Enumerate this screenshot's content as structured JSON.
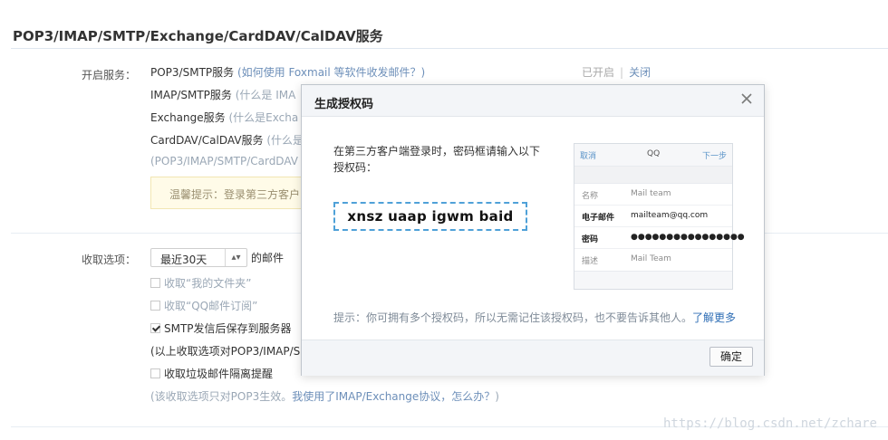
{
  "section": {
    "title": "POP3/IMAP/SMTP/Exchange/CardDAV/CalDAV服务"
  },
  "services": {
    "label": "开启服务：",
    "rows": [
      {
        "name": "POP3/SMTP服务",
        "note": " (如何使用 Foxmail 等软件收发邮件？)"
      },
      {
        "name": "IMAP/SMTP服务",
        "note": " (什么是 IMA"
      },
      {
        "name": "Exchange服务",
        "note": " (什么是Excha"
      },
      {
        "name": "CardDAV/CalDAV服务",
        "note": " (什么是"
      }
    ],
    "extra_note": "(POP3/IMAP/SMTP/CardDAV",
    "status_enabled": "已开启",
    "status_sep": "|",
    "status_off": "关闭",
    "tip": "温馨提示：登录第三方客户"
  },
  "receive": {
    "label": "收取选项：",
    "select_value": "最近30天",
    "select_suffix": "的邮件",
    "options": [
      {
        "label": "收取“我的文件夹”",
        "checked": false
      },
      {
        "label": "收取“QQ邮件订阅”",
        "checked": false
      },
      {
        "label": "SMTP发信后保存到服务器",
        "checked": true
      },
      {
        "label": "收取垃圾邮件隔离提醒",
        "checked": false
      }
    ],
    "partial_note": "(以上收取选项对POP3/IMAP/S",
    "bottom_note_prefix": "(该收取选项只对POP3生效。",
    "bottom_note_link": "我使用了IMAP/Exchange协议，怎么办？",
    "bottom_note_suffix": ")"
  },
  "modal": {
    "title": "生成授权码",
    "instruction_line1": "在第三方客户端登录时，密码框请输入以下",
    "instruction_line2": "授权码：",
    "auth_code": "xnsz uaap igwm baid",
    "hint_prefix": "提示：你可拥有多个授权码，所以无需记住该授权码，也不要告诉其他人。",
    "hint_link": "了解更多",
    "ok_label": "确定",
    "phone": {
      "cancel": "取消",
      "title": "QQ",
      "next": "下一步",
      "rows": [
        {
          "key": "名称",
          "value": "Mail team",
          "style": "dim"
        },
        {
          "key": "电子邮件",
          "value": "mailteam@qq.com",
          "style": "strong"
        },
        {
          "key": "密码",
          "value": "●●●●●●●●●●●●●●●●",
          "style": "strong"
        },
        {
          "key": "描述",
          "value": "Mail Team",
          "style": "dim"
        }
      ]
    }
  },
  "watermark": "https://blog.csdn.net/zchare",
  "colors": {
    "accent_link": "#6d8fb9",
    "dashed_border": "#4fa1d8",
    "modal_header_bg": "#f3f5f8"
  },
  "icons": {
    "close": "close-icon",
    "select_arrow": "select-arrow-icon",
    "checkbox": "checkbox-icon"
  }
}
